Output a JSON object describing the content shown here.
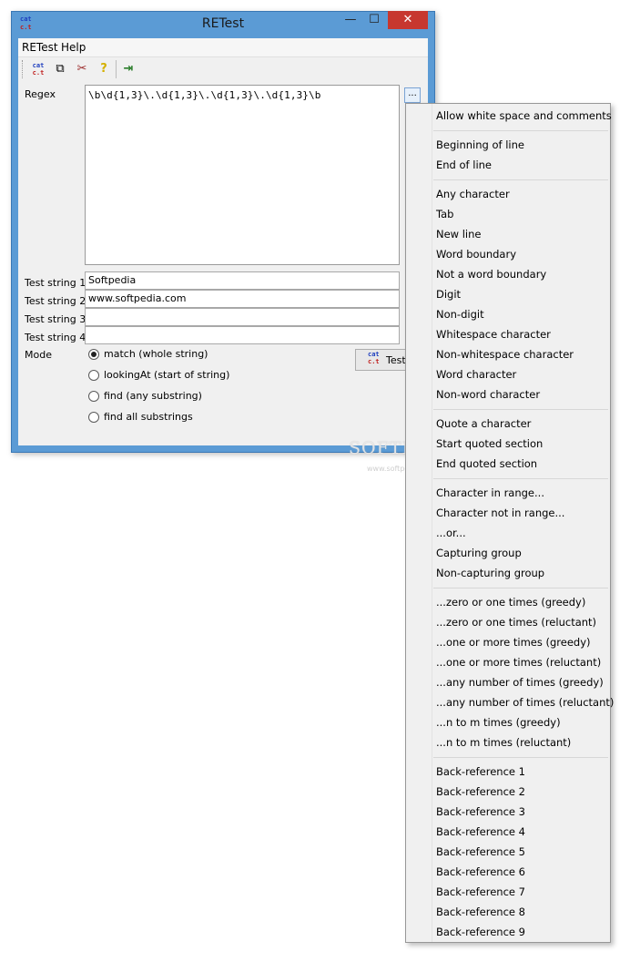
{
  "window": {
    "title": "RETest",
    "app_icon_lines": [
      "cat",
      "c.t"
    ],
    "minimize_glyph": "—",
    "maximize_glyph": "☐",
    "close_glyph": "✕"
  },
  "menu": {
    "retest": "RETest",
    "help": "Help"
  },
  "toolbar": {
    "icons": [
      "regex-icon",
      "open-icon",
      "tools-icon",
      "help-icon",
      "exit-icon"
    ],
    "glyphs": [
      "",
      "⧉",
      "✂",
      "?",
      "⇥"
    ]
  },
  "regex": {
    "label": "Regex",
    "value": "\\b\\d{1,3}\\.\\d{1,3}\\.\\d{1,3}\\.\\d{1,3}\\b",
    "more_button": "..."
  },
  "test_strings": [
    {
      "label": "Test string 1",
      "value": "Softpedia"
    },
    {
      "label": "Test string 2",
      "value": "www.softpedia.com"
    },
    {
      "label": "Test string 3",
      "value": ""
    },
    {
      "label": "Test string 4",
      "value": ""
    }
  ],
  "mode": {
    "label": "Mode",
    "options": [
      {
        "label": "match (whole string)",
        "selected": true
      },
      {
        "label": "lookingAt (start of string)",
        "selected": false
      },
      {
        "label": "find (any substring)",
        "selected": false
      },
      {
        "label": "find all substrings",
        "selected": false
      }
    ]
  },
  "test_button": {
    "label": "Test"
  },
  "watermark": {
    "main": "SOFTPEDIA",
    "url": "www.softpedia.com"
  },
  "context_menu": {
    "groups": [
      [
        "Allow white space and comments"
      ],
      [
        "Beginning of line",
        "End of line"
      ],
      [
        "Any character",
        "Tab",
        "New line",
        "Word boundary",
        "Not a word boundary",
        "Digit",
        "Non-digit",
        "Whitespace character",
        "Non-whitespace character",
        "Word character",
        "Non-word character"
      ],
      [
        "Quote a character",
        "Start quoted section",
        "End quoted section"
      ],
      [
        "Character in range...",
        "Character not in range...",
        "...or...",
        "Capturing group",
        "Non-capturing group"
      ],
      [
        "...zero or one times (greedy)",
        "...zero or one times (reluctant)",
        "...one or more times (greedy)",
        "...one or more times (reluctant)",
        "...any number of times (greedy)",
        "...any number of times (reluctant)",
        "...n to m times (greedy)",
        "...n to m times (reluctant)"
      ],
      [
        "Back-reference 1",
        "Back-reference 2",
        "Back-reference 3",
        "Back-reference 4",
        "Back-reference 5",
        "Back-reference 6",
        "Back-reference 7",
        "Back-reference 8",
        "Back-reference 9"
      ]
    ]
  },
  "colors": {
    "window_frame": "#5b9bd5",
    "close_button": "#c7372f",
    "icon_blue": "#1f3fbf",
    "icon_red": "#c0201f"
  }
}
